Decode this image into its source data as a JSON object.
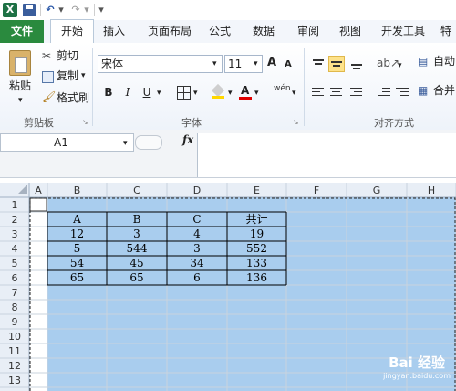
{
  "app": {
    "logo_glyph": "X",
    "qat_undo": "↶",
    "qat_redo": "↷",
    "qat_more": "▾"
  },
  "tabs": [
    "文件",
    "开始",
    "插入",
    "页面布局",
    "公式",
    "数据",
    "审阅",
    "视图",
    "开发工具",
    "特"
  ],
  "ribbon": {
    "clipboard": {
      "paste": "粘贴",
      "cut": "剪切",
      "copy": "复制",
      "format_painter": "格式刷",
      "label": "剪贴板"
    },
    "font": {
      "name": "宋体",
      "size": "11",
      "grow": "A",
      "shrink": "A",
      "bold": "B",
      "italic": "I",
      "underline": "U",
      "font_color_letter": "A",
      "phonetic": "wén",
      "label": "字体"
    },
    "alignment": {
      "wrap": "自动",
      "merge": "合并",
      "label": "对齐方式"
    }
  },
  "formula_bar": {
    "name_box": "A1",
    "fx": "fx",
    "formula": ""
  },
  "grid": {
    "columns": [
      "A",
      "B",
      "C",
      "D",
      "E",
      "F",
      "G",
      "H"
    ],
    "rows": [
      "1",
      "2",
      "3",
      "4",
      "5",
      "6",
      "7",
      "8",
      "9",
      "10",
      "11",
      "12",
      "13"
    ],
    "table": {
      "header": [
        "A",
        "B",
        "C",
        "共计"
      ],
      "rows": [
        [
          "12",
          "3",
          "4",
          "19"
        ],
        [
          "5",
          "544",
          "3",
          "552"
        ],
        [
          "54",
          "45",
          "34",
          "133"
        ],
        [
          "65",
          "65",
          "6",
          "136"
        ]
      ]
    }
  },
  "colors": {
    "selection": "#a9cdee",
    "file_tab": "#2a8a3e",
    "header_bg": "#e8eef6"
  },
  "watermark": {
    "brand": "Bai 经验",
    "url": "jingyan.baidu.com"
  }
}
